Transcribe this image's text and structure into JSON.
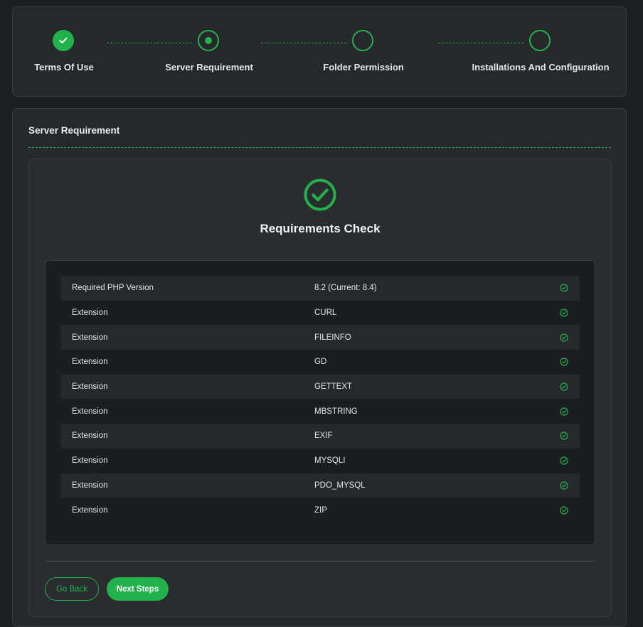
{
  "stepper": {
    "steps": [
      {
        "label": "Terms Of Use",
        "state": "done"
      },
      {
        "label": "Server Requirement",
        "state": "active"
      },
      {
        "label": "Folder Permission",
        "state": "pending"
      },
      {
        "label": "Installations And Configuration",
        "state": "pending"
      }
    ]
  },
  "main": {
    "section_title": "Server Requirement",
    "check_title": "Requirements Check",
    "requirements": [
      {
        "name": "Required PHP Version",
        "value": "8.2 (Current: 8.4)",
        "status": "ok"
      },
      {
        "name": "Extension",
        "value": "CURL",
        "status": "ok"
      },
      {
        "name": "Extension",
        "value": "FILEINFO",
        "status": "ok"
      },
      {
        "name": "Extension",
        "value": "GD",
        "status": "ok"
      },
      {
        "name": "Extension",
        "value": "GETTEXT",
        "status": "ok"
      },
      {
        "name": "Extension",
        "value": "MBSTRING",
        "status": "ok"
      },
      {
        "name": "Extension",
        "value": "EXIF",
        "status": "ok"
      },
      {
        "name": "Extension",
        "value": "MYSQLI",
        "status": "ok"
      },
      {
        "name": "Extension",
        "value": "PDO_MYSQL",
        "status": "ok"
      },
      {
        "name": "Extension",
        "value": "ZIP",
        "status": "ok"
      }
    ],
    "buttons": {
      "back": "Go Back",
      "next": "Next Steps"
    }
  },
  "colors": {
    "accent": "#22b24c",
    "background": "#1e1f22",
    "card": "#26282b"
  },
  "icons": {
    "done_step": "check-icon",
    "row_status": "check-circle-icon",
    "hero": "check-circle-icon"
  }
}
